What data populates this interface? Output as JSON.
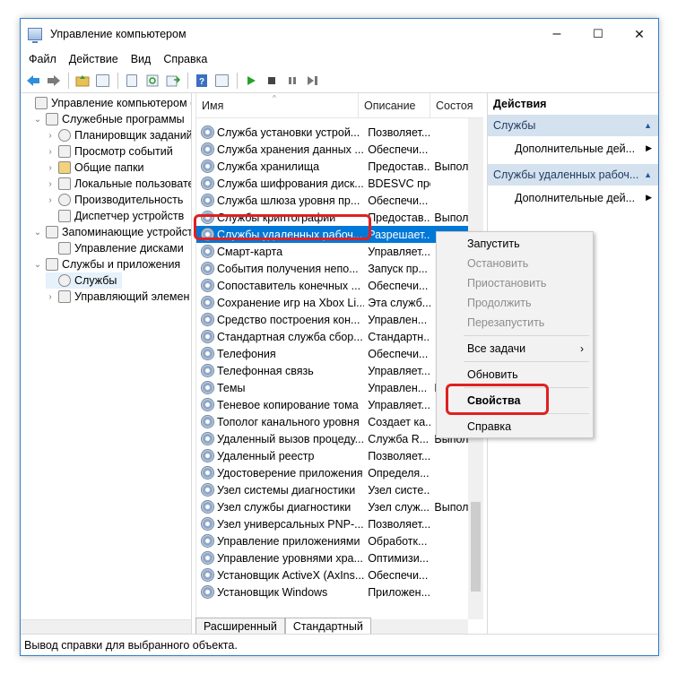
{
  "window": {
    "title": "Управление компьютером",
    "controls": {
      "minimize": "–",
      "maximize": "☐",
      "close": "✕"
    }
  },
  "menubar": [
    "Файл",
    "Действие",
    "Вид",
    "Справка"
  ],
  "toolbar": [
    "back-arrow-icon",
    "forward-arrow-icon",
    "folder-up-icon",
    "show-hide-tree-icon",
    "properties-icon",
    "refresh-icon",
    "export-list-icon",
    "help-icon",
    "help-topics-icon",
    "play-icon",
    "stop-icon",
    "pause-icon",
    "restart-icon"
  ],
  "tree": [
    {
      "label": "Управление компьютером (л",
      "level": 0,
      "toggle": ""
    },
    {
      "label": "Служебные программы",
      "level": 1,
      "toggle": "⌄"
    },
    {
      "label": "Планировщик заданий",
      "level": 2,
      "toggle": "›"
    },
    {
      "label": "Просмотр событий",
      "level": 2,
      "toggle": "›"
    },
    {
      "label": "Общие папки",
      "level": 2,
      "toggle": "›"
    },
    {
      "label": "Локальные пользовате",
      "level": 2,
      "toggle": "›"
    },
    {
      "label": "Производительность",
      "level": 2,
      "toggle": "›"
    },
    {
      "label": "Диспетчер устройств",
      "level": 2,
      "toggle": ""
    },
    {
      "label": "Запоминающие устройст",
      "level": 1,
      "toggle": "⌄"
    },
    {
      "label": "Управление дисками",
      "level": 2,
      "toggle": ""
    },
    {
      "label": "Службы и приложения",
      "level": 1,
      "toggle": "⌄"
    },
    {
      "label": "Службы",
      "level": 2,
      "toggle": "",
      "selected": true
    },
    {
      "label": "Управляющий элемен",
      "level": 2,
      "toggle": "›"
    }
  ],
  "list": {
    "columns": [
      "Имя",
      "Описание",
      "Состоя"
    ],
    "rows": [
      [
        "Служба установки устрой...",
        "Позволяет...",
        ""
      ],
      [
        "Служба хранения данных ...",
        "Обеспечи...",
        ""
      ],
      [
        "Служба хранилища",
        "Предостав...",
        "Выпол"
      ],
      [
        "Служба шифрования диск...",
        "BDESVC пре...",
        ""
      ],
      [
        "Служба шлюза уровня пр...",
        "Обеспечи...",
        ""
      ],
      [
        "Службы криптографии",
        "Предостав...",
        "Выпол"
      ],
      [
        "Службы удаленных рабоч...",
        "Разрешает...",
        ""
      ],
      [
        "Смарт-карта",
        "Управляет...",
        ""
      ],
      [
        "События получения непо...",
        "Запуск пр...",
        ""
      ],
      [
        "Сопоставитель конечных ...",
        "Обеспечи...",
        ""
      ],
      [
        "Сохранение игр на Xbox Li...",
        "Эта служб...",
        ""
      ],
      [
        "Средство построения кон...",
        "Управлен...",
        ""
      ],
      [
        "Стандартная служба сбор...",
        "Стандартн...",
        ""
      ],
      [
        "Телефония",
        "Обеспечи...",
        ""
      ],
      [
        "Телефонная связь",
        "Управляет...",
        ""
      ],
      [
        "Темы",
        "Управлен...",
        "Выпол"
      ],
      [
        "Теневое копирование тома",
        "Управляет...",
        ""
      ],
      [
        "Тополог канального уровня",
        "Создает ка...",
        ""
      ],
      [
        "Удаленный вызов процеду...",
        "Служба R...",
        "Выпол"
      ],
      [
        "Удаленный реестр",
        "Позволяет...",
        ""
      ],
      [
        "Удостоверение приложения",
        "Определя...",
        ""
      ],
      [
        "Узел системы диагностики",
        "Узел систе...",
        ""
      ],
      [
        "Узел службы диагностики",
        "Узел служ...",
        "Выпол"
      ],
      [
        "Узел универсальных PNP-...",
        "Позволяет...",
        ""
      ],
      [
        "Управление приложениями",
        "Обработк...",
        ""
      ],
      [
        "Управление уровнями хра...",
        "Оптимизи...",
        ""
      ],
      [
        "Установщик ActiveX (AxIns...",
        "Обеспечи...",
        ""
      ],
      [
        "Установщик Windows",
        "Приложен...",
        ""
      ]
    ],
    "selected_index": 6,
    "tabs": [
      "Расширенный",
      "Стандартный"
    ]
  },
  "actions": {
    "header": "Действия",
    "sections": [
      {
        "title": "Службы",
        "item": "Дополнительные дей..."
      },
      {
        "title": "Службы удаленных рабоч...",
        "item": "Дополнительные дей..."
      }
    ]
  },
  "context_menu": {
    "items": [
      {
        "label": "Запустить",
        "enabled": true
      },
      {
        "label": "Остановить",
        "enabled": false
      },
      {
        "label": "Приостановить",
        "enabled": false
      },
      {
        "label": "Продолжить",
        "enabled": false
      },
      {
        "label": "Перезапустить",
        "enabled": false
      },
      {
        "label": "Все задачи",
        "enabled": true,
        "submenu": "›"
      },
      {
        "label": "Обновить",
        "enabled": true
      },
      {
        "label": "Свойства",
        "enabled": true,
        "bold": true
      },
      {
        "label": "Справка",
        "enabled": true
      }
    ]
  },
  "statusbar": "Вывод справки для выбранного объекта.",
  "colors": {
    "selection": "#0078d7",
    "highlight_box": "#e02020",
    "actions_section": "#d4e1ef"
  }
}
